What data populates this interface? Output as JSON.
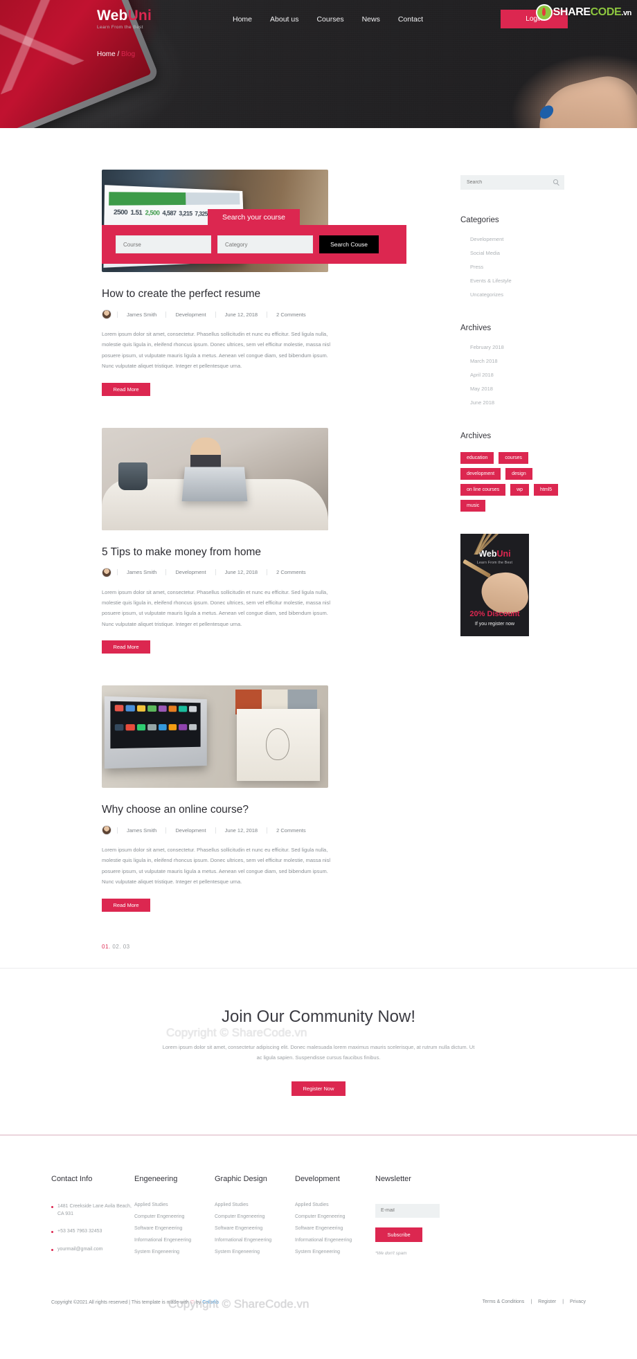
{
  "brand": {
    "logo_main": "Web",
    "logo_accent": "Uni",
    "tagline": "Learn From the Best",
    "watermark": "ShareCode.vn",
    "mark_part1": "SHARE",
    "mark_part2": "CODE",
    "mark_part3": ".vn"
  },
  "nav": {
    "items": [
      "Home",
      "About us",
      "Courses",
      "News",
      "Contact"
    ],
    "login_label": "Login"
  },
  "breadcrumb": {
    "home": "Home",
    "separator": "/",
    "current": "Blog"
  },
  "search_hero": {
    "tab_label": "Search your course",
    "course_placeholder": "Course",
    "category_placeholder": "Category",
    "submit_label": "Search Couse"
  },
  "posts": [
    {
      "title": "How to create the perfect resume",
      "author": "James Smith",
      "category": "Development",
      "date": "June 12, 2018",
      "comments": "2 Comments",
      "excerpt": "Lorem ipsum dolor sit amet, consectetur. Phasellus sollicitudin et nunc eu efficitur. Sed ligula nulla, molestie quis ligula in, eleifend rhoncus ipsum. Donec ultrices, sem vel efficitur molestie, massa nisl posuere ipsum, ut vulputate mauris ligula a metus. Aenean vel congue diam, sed bibendum ipsum. Nunc vulputate aliquet tristique. Integer et pellentesque urna.",
      "read_more": "Read More"
    },
    {
      "title": "5 Tips to make money from home",
      "author": "James Smith",
      "category": "Development",
      "date": "June 12, 2018",
      "comments": "2 Comments",
      "excerpt": "Lorem ipsum dolor sit amet, consectetur. Phasellus sollicitudin et nunc eu efficitur. Sed ligula nulla, molestie quis ligula in, eleifend rhoncus ipsum. Donec ultrices, sem vel efficitur molestie, massa nisl posuere ipsum, ut vulputate mauris ligula a metus. Aenean vel congue diam, sed bibendum ipsum. Nunc vulputate aliquet tristique. Integer et pellentesque urna.",
      "read_more": "Read More"
    },
    {
      "title": "Why choose an online course?",
      "author": "James Smith",
      "category": "Development",
      "date": "June 12, 2018",
      "comments": "2 Comments",
      "excerpt": "Lorem ipsum dolor sit amet, consectetur. Phasellus sollicitudin et nunc eu efficitur. Sed ligula nulla, molestie quis ligula in, eleifend rhoncus ipsum. Donec ultrices, sem vel efficitur molestie, massa nisl posuere ipsum, ut vulputate mauris ligula a metus. Aenean vel congue diam, sed bibendum ipsum. Nunc vulputate aliquet tristique. Integer et pellentesque urna.",
      "read_more": "Read More"
    }
  ],
  "pagination": {
    "pages": [
      "01.",
      "02.",
      "03"
    ],
    "active_index": 0
  },
  "sidebar": {
    "search_placeholder": "Search",
    "categories_title": "Categories",
    "categories": [
      "Developement",
      "Social Media",
      "Press",
      "Events & Lifestyle",
      "Uncategorizes"
    ],
    "archives_title": "Archives",
    "archives": [
      "February 2018",
      "March 2018",
      "April 2018",
      "May 2018",
      "June 2018"
    ],
    "tags_title": "Archives",
    "tags": [
      "education",
      "courses",
      "development",
      "design",
      "on line courses",
      "wp",
      "html5",
      "music"
    ],
    "promo": {
      "logo_main": "Web",
      "logo_accent": "Uni",
      "tagline": "Learn From the Best",
      "discount": "20% Discount",
      "note": "If you register now"
    }
  },
  "community": {
    "title": "Join Our Community Now!",
    "text": "Lorem ipsum dolor sit amet, consectetur adipiscing elit. Donec malesuada lorem maximus mauris scelerisque, at rutrum nulla dictum. Ut ac ligula sapien. Suspendisse cursus faucibus finibus.",
    "button": "Register Now"
  },
  "footer": {
    "contact": {
      "title": "Contact Info",
      "address": "1481 Creekside Lane Avila Beach, CA 931",
      "phone": "+53 345 7963 32453",
      "email": "yourmail@gmail.com"
    },
    "columns": [
      {
        "title": "Engeneering",
        "items": [
          "Applied Studies",
          "Computer Engeneering",
          "Software Engeneering",
          "Informational Engeneering",
          "System Engeneering"
        ]
      },
      {
        "title": "Graphic Design",
        "items": [
          "Applied Studies",
          "Computer Engeneering",
          "Software Engeneering",
          "Informational Engeneering",
          "System Engeneering"
        ]
      },
      {
        "title": "Development",
        "items": [
          "Applied Studies",
          "Computer Engeneering",
          "Software Engeneering",
          "Informational Engeneering",
          "System Engeneering"
        ]
      }
    ],
    "newsletter": {
      "title": "Newsletter",
      "placeholder": "E-mail",
      "button": "Subscribe",
      "note": "*We don't spam"
    },
    "copyright_pre": "Copyright ©2021 All rights reserved | This template is made with ",
    "copyright_heart": "♡",
    "copyright_by": " by ",
    "copyright_brand": "Colorlib",
    "links": [
      "Terms & Conditions",
      "|",
      "Register",
      "|",
      "Privacy"
    ]
  },
  "colors": {
    "accent": "#dc2750",
    "dark": "#232323",
    "muted": "#9ba0a4"
  }
}
